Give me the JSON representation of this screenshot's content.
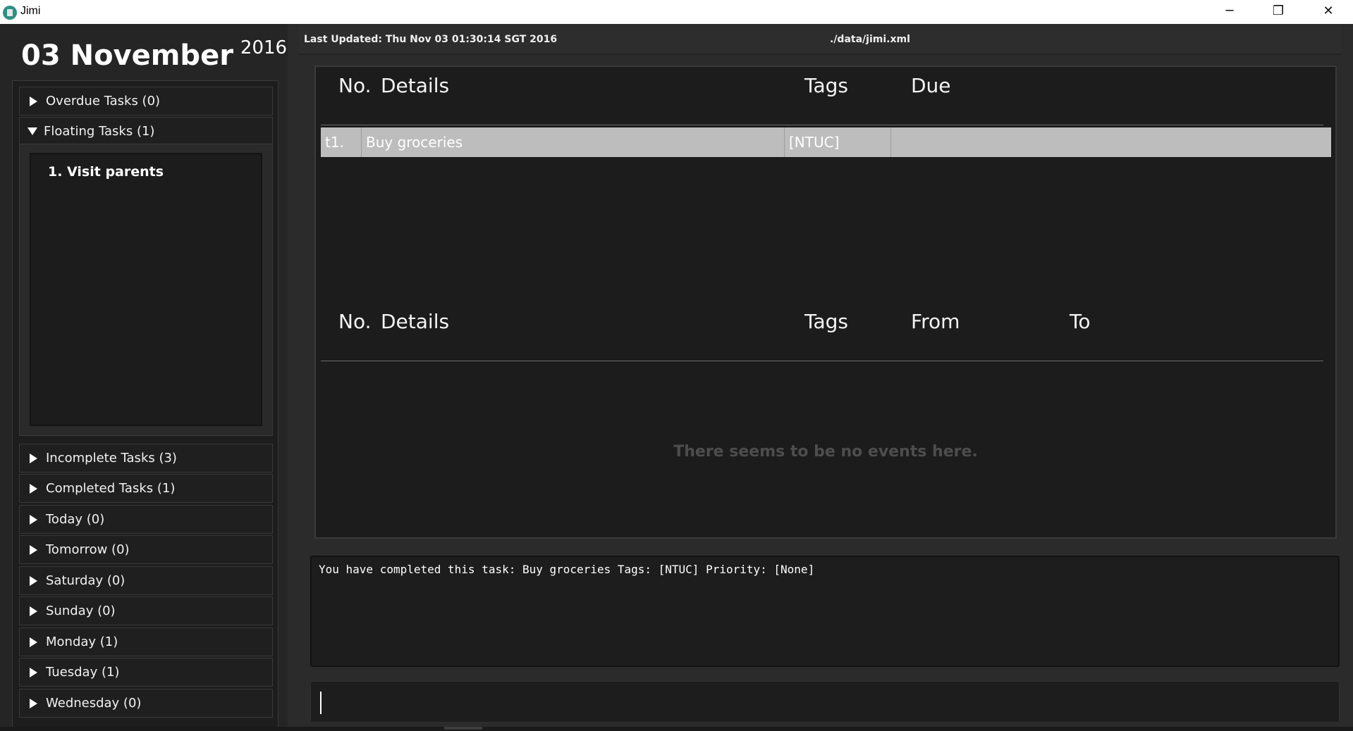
{
  "window": {
    "title": "Jimi",
    "minimize_icon": "─",
    "maximize_icon": "❐",
    "close_icon": "✕"
  },
  "date": {
    "day_month": "03 November",
    "year": "2016"
  },
  "sidebar": {
    "overdue": "Overdue Tasks (0)",
    "floating": "Floating Tasks (1)",
    "floating_items": [
      "1. Visit parents"
    ],
    "incomplete": "Incomplete Tasks (3)",
    "completed": "Completed Tasks (1)",
    "today": "Today (0)",
    "tomorrow": "Tomorrow (0)",
    "saturday": "Saturday (0)",
    "sunday": "Sunday (0)",
    "monday": "Monday (1)",
    "tuesday": "Tuesday (1)",
    "wednesday": "Wednesday (0)"
  },
  "header": {
    "last_updated": "Last Updated: Thu Nov 03 01:30:14 SGT 2016",
    "file_path": "./data/jimi.xml"
  },
  "tasks_table": {
    "columns": [
      "No.",
      "Details",
      "Tags",
      "Due"
    ],
    "rows": [
      {
        "no": "t1.",
        "details": "Buy groceries",
        "tags": "[NTUC]",
        "due": ""
      }
    ]
  },
  "events_table": {
    "columns": [
      "No.",
      "Details",
      "Tags",
      "From",
      "To"
    ],
    "empty_message": "There seems to be no events here."
  },
  "output": {
    "text": "You have completed this task: Buy groceries Tags: [NTUC] Priority: [None]"
  },
  "command": {
    "value": ""
  }
}
